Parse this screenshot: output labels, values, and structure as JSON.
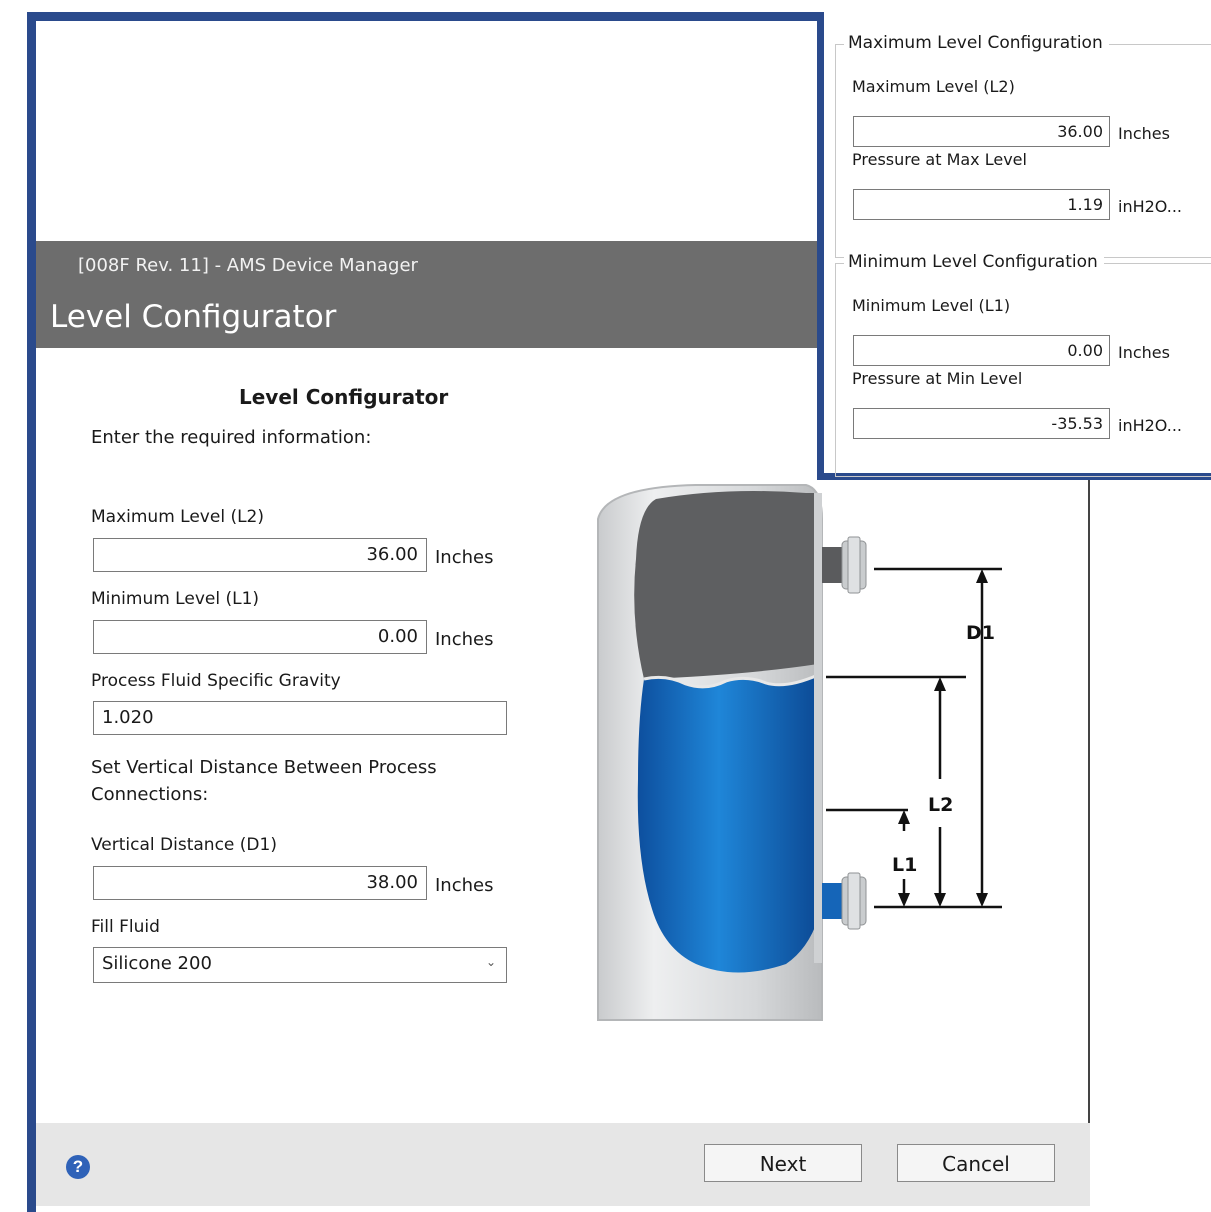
{
  "dialog": {
    "window_title": "[008F Rev. 11] - AMS Device Manager",
    "header_title": "Level Configurator",
    "section_title": "Level Configurator",
    "instructions": "Enter the required information:",
    "max_level": {
      "label": "Maximum Level (L2)",
      "value": "36.00",
      "unit": "Inches"
    },
    "min_level": {
      "label": "Minimum Level (L1)",
      "value": "0.00",
      "unit": "Inches"
    },
    "specific_gravity": {
      "label": "Process Fluid Specific Gravity",
      "value": "1.020"
    },
    "vertical_distance_heading": "Set Vertical Distance Between Process Connections:",
    "vertical_distance": {
      "label": "Vertical Distance (D1)",
      "value": "38.00",
      "unit": "Inches"
    },
    "fill_fluid": {
      "label": "Fill Fluid",
      "value": "Silicone 200"
    },
    "diagram_labels": {
      "d1": "D1",
      "l2": "L2",
      "l1": "L1"
    },
    "help_glyph": "?",
    "next_label": "Next",
    "cancel_label": "Cancel"
  },
  "overlay": {
    "max_group": {
      "title": "Maximum Level Configuration",
      "level_label": "Maximum Level (L2)",
      "level_value": "36.00",
      "level_unit": "Inches",
      "pressure_label": "Pressure at Max Level",
      "pressure_value": "1.19",
      "pressure_unit": "inH2O..."
    },
    "min_group": {
      "title": "Minimum Level Configuration",
      "level_label": "Minimum Level (L1)",
      "level_value": "0.00",
      "level_unit": "Inches",
      "pressure_label": "Pressure at Min Level",
      "pressure_value": "-35.53",
      "pressure_unit": "inH2O..."
    }
  },
  "colors": {
    "frame_blue": "#2a4a8c",
    "header_gray": "#6d6d6d",
    "fluid_blue": "#1a6fc0",
    "help_blue": "#2f62b8"
  },
  "icons": {
    "help": "help-circle-icon",
    "dropdown": "chevron-down-icon"
  }
}
